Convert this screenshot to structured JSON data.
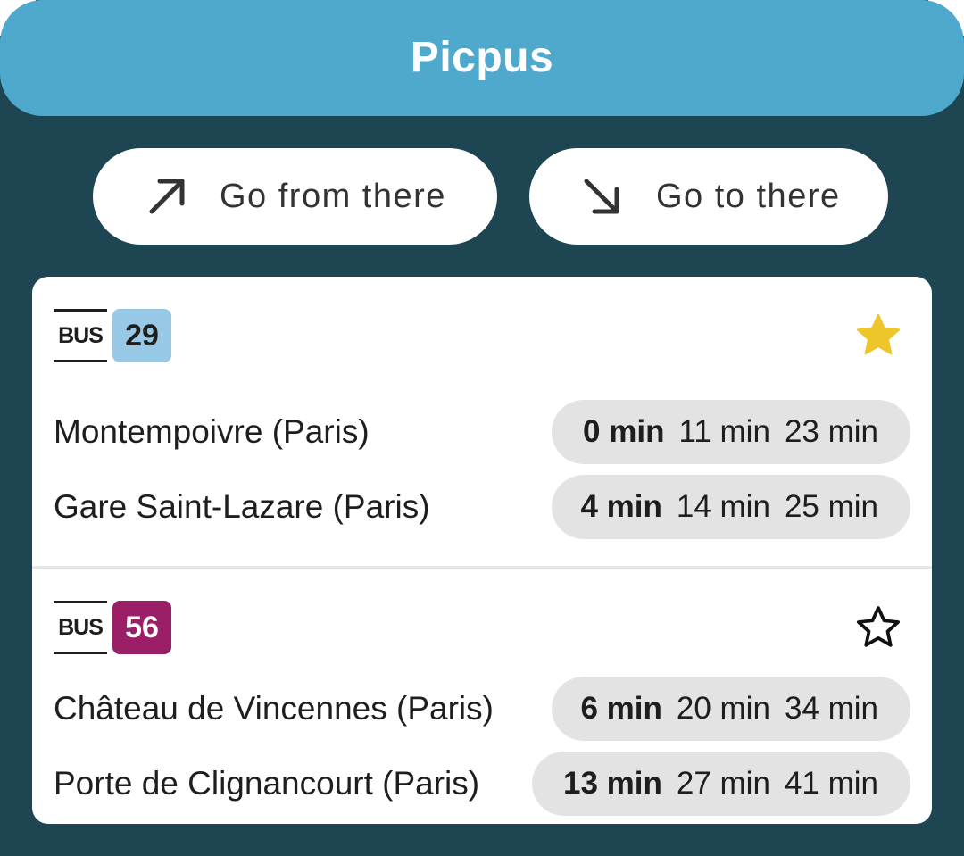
{
  "header": {
    "title": "Picpus"
  },
  "actions": {
    "from_label": "Go from there",
    "to_label": "Go to there"
  },
  "lines": [
    {
      "mode": "BUS",
      "number": "29",
      "badge_color": "#97c9e6",
      "badge_text_color": "#1e1e1e",
      "favorite": true,
      "departures": [
        {
          "destination": "Montempoivre (Paris)",
          "times": [
            "0 min",
            "11 min",
            "23 min"
          ]
        },
        {
          "destination": "Gare Saint-Lazare (Paris)",
          "times": [
            "4 min",
            "14 min",
            "25 min"
          ]
        }
      ]
    },
    {
      "mode": "BUS",
      "number": "56",
      "badge_color": "#9b1f67",
      "badge_text_color": "#ffffff",
      "favorite": false,
      "departures": [
        {
          "destination": "Château de Vincennes (Paris)",
          "times": [
            "6 min",
            "20 min",
            "34 min"
          ]
        },
        {
          "destination": "Porte de Clignancourt (Paris)",
          "times": [
            "13 min",
            "27 min",
            "41 min"
          ]
        }
      ]
    }
  ],
  "colors": {
    "header": "#4fa9cc",
    "background": "#1d4652",
    "star_filled": "#ecc62a"
  }
}
